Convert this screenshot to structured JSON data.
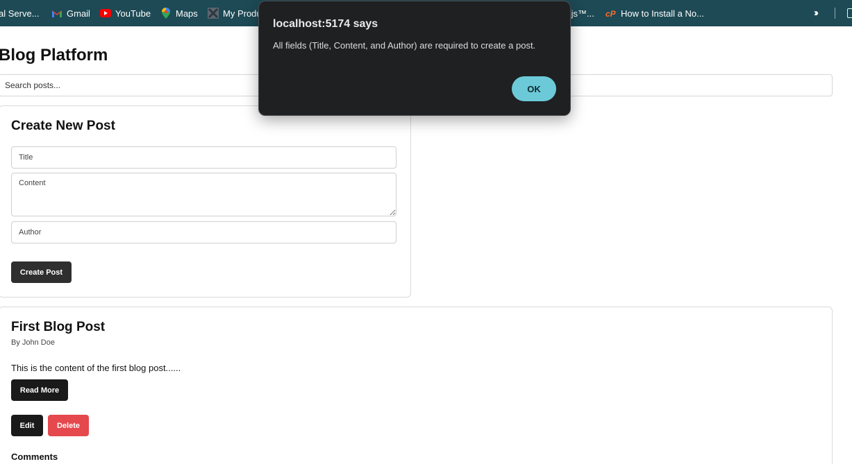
{
  "bookmarks": [
    {
      "label": "al Serve...",
      "icon": "server-icon"
    },
    {
      "label": "Gmail",
      "icon": "gmail-icon"
    },
    {
      "label": "YouTube",
      "icon": "youtube-icon"
    },
    {
      "label": "Maps",
      "icon": "maps-pin-icon"
    },
    {
      "label": "My Produ",
      "icon": "product-icon"
    },
    {
      "label": ".js™...",
      "icon": ""
    },
    {
      "label": "How to Install a No...",
      "icon": "cpanel-icon"
    }
  ],
  "bookmarks_bar_color": "#1d4a55",
  "page": {
    "title": "Blog Platform",
    "search_placeholder": "Search posts..."
  },
  "create_form": {
    "heading": "Create New Post",
    "title_placeholder": "Title",
    "content_placeholder": "Content",
    "author_placeholder": "Author",
    "submit_label": "Create Post"
  },
  "post": {
    "title": "First Blog Post",
    "author": "By John Doe",
    "excerpt": "This is the content of the first blog post......",
    "read_more_label": "Read More",
    "edit_label": "Edit",
    "delete_label": "Delete",
    "comments_heading": "Comments"
  },
  "dialog": {
    "title": "localhost:5174 says",
    "message": "All fields (Title, Content, and Author) are required to create a post.",
    "ok_label": "OK",
    "ok_color": "#6ccad8"
  },
  "colors": {
    "delete": "#e5484d",
    "primary_button": "#1a1a1a"
  }
}
